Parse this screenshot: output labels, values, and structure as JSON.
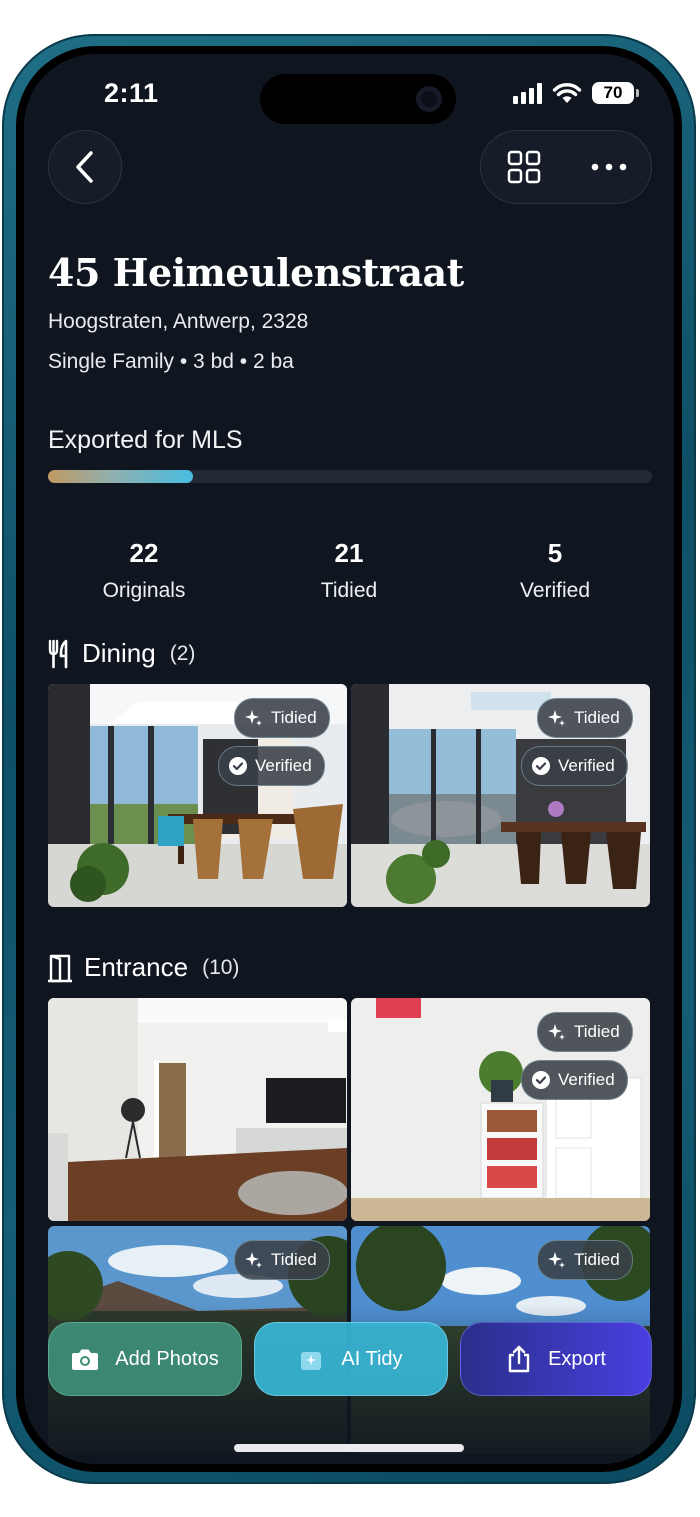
{
  "status_bar": {
    "time": "2:11",
    "battery": "70"
  },
  "property": {
    "title": "45 Heimeulenstraat",
    "address": "Hoogstraten, Antwerp, 2328",
    "details": "Single Family • 3 bd • 2 ba"
  },
  "export": {
    "label": "Exported for MLS",
    "progress": 0.24
  },
  "stats": [
    {
      "value": "22",
      "label": "Originals"
    },
    {
      "value": "21",
      "label": "Tidied"
    },
    {
      "value": "5",
      "label": "Verified"
    }
  ],
  "sections": [
    {
      "name": "Dining",
      "count": "(2)",
      "icon": "fork-knife-icon"
    },
    {
      "name": "Entrance",
      "count": "(10)",
      "icon": "door-icon"
    }
  ],
  "badges": {
    "tidied": "Tidied",
    "verified": "Verified"
  },
  "actions": {
    "add_photos": "Add Photos",
    "ai_tidy": "AI Tidy",
    "export": "Export"
  },
  "colors": {
    "background": "#101620",
    "add_photos": "#3f8f78",
    "ai_tidy": "#37b6d6",
    "export": "#3d3ad0"
  }
}
